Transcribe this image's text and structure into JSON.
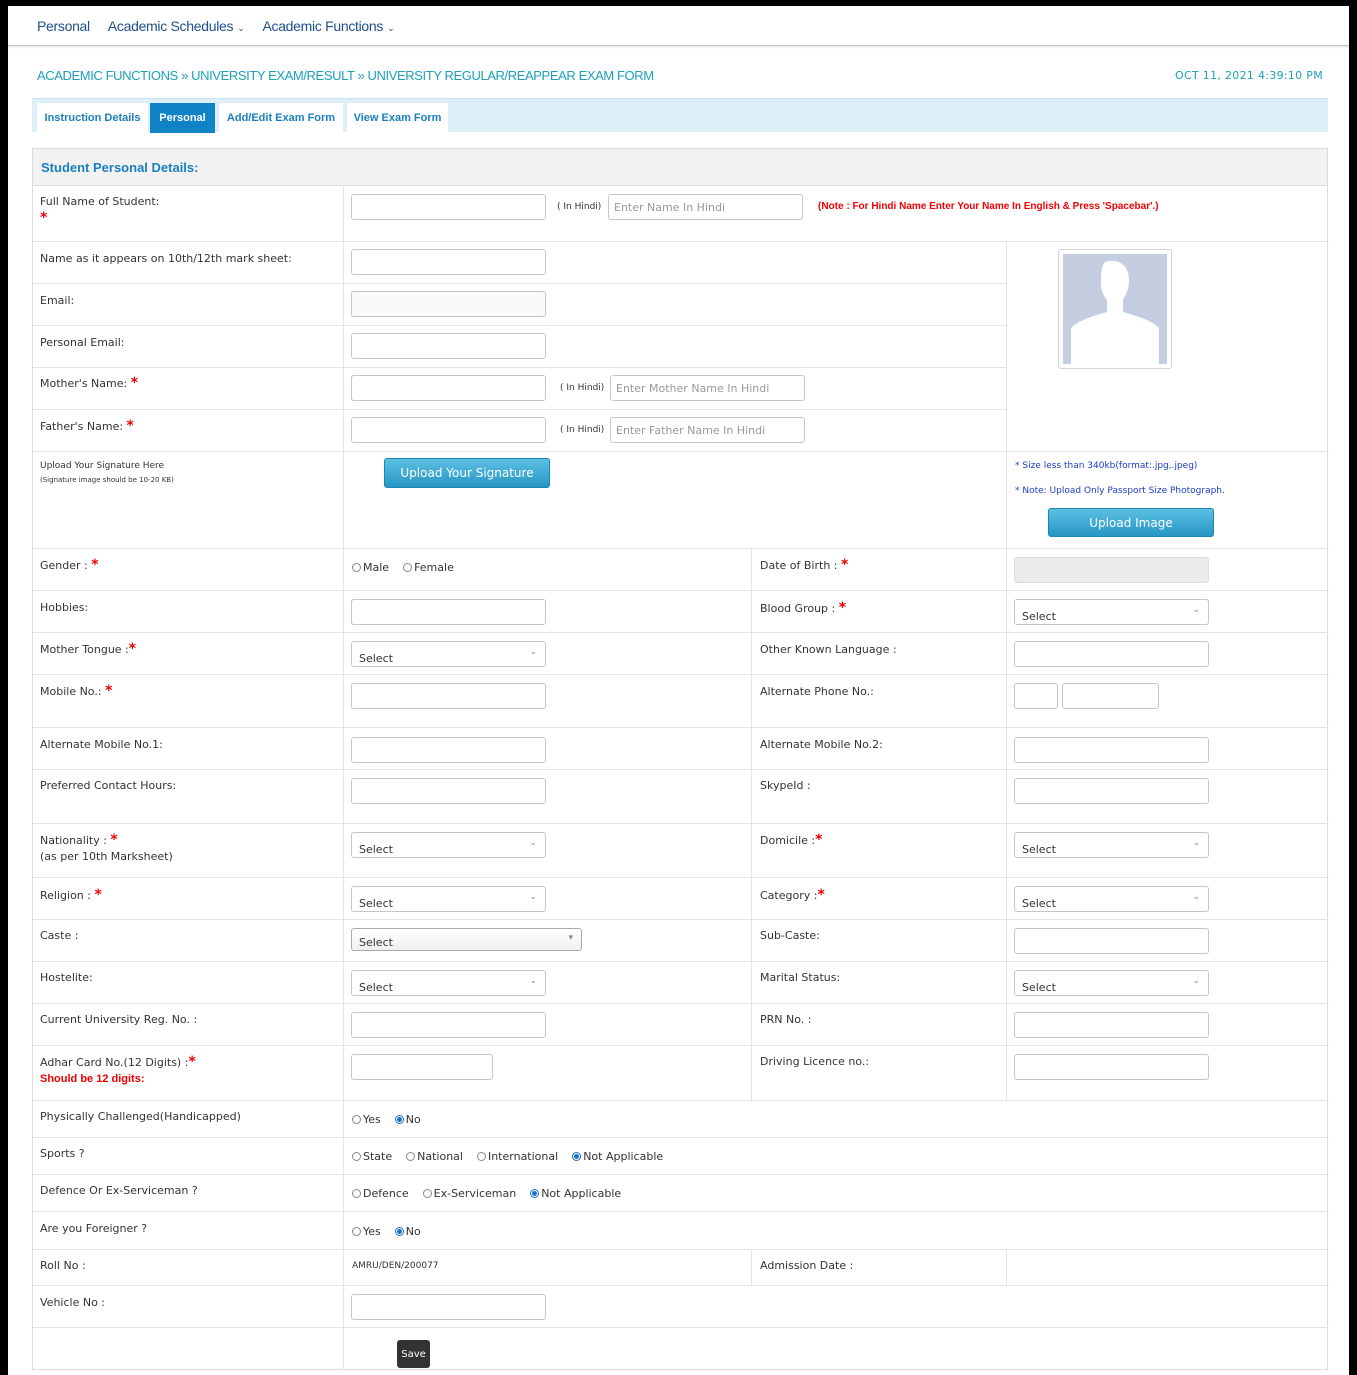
{
  "nav": {
    "items": [
      {
        "label": "Personal",
        "dropdown": false
      },
      {
        "label": "Academic Schedules",
        "dropdown": true
      },
      {
        "label": "Academic Functions",
        "dropdown": true
      }
    ]
  },
  "breadcrumb": "ACADEMIC FUNCTIONS » UNIVERSITY EXAM/RESULT » UNIVERSITY REGULAR/REAPPEAR EXAM FORM",
  "datetime": "OCT 11, 2021  4:39:10 PM",
  "tabs": [
    {
      "label": "Instruction Details",
      "active": false
    },
    {
      "label": "Personal",
      "active": true
    },
    {
      "label": "Add/Edit Exam Form",
      "active": false
    },
    {
      "label": "View Exam Form",
      "active": false
    }
  ],
  "section_title": "Student Personal Details:",
  "labels": {
    "full_name": "Full Name of Student:",
    "in_hindi": "( In Hindi)",
    "hindi_note": "(Note : For Hindi Name Enter Your Name In English & Press 'Spacebar'.)",
    "marksheet_name": "Name as it appears on 10th/12th mark sheet:",
    "email": "Email:",
    "personal_email": "Personal Email:",
    "mother_name": "Mother's Name:",
    "father_name": "Father's Name:",
    "signature_title": "Upload Your Signature Here",
    "signature_hint": "(Signature image should be 10-20 KB)",
    "photo_size": "* Size less than 340kb(format:.jpg,.jpeg)",
    "photo_note": "* Note: Upload Only Passport Size Photograph.",
    "gender": "Gender :",
    "dob": "Date of Birth :",
    "hobbies": "Hobbies:",
    "blood_group": "Blood Group :",
    "mother_tongue": "Mother Tongue :",
    "other_language": "Other Known Language :",
    "mobile": "Mobile No.:",
    "alt_phone": "Alternate Phone No.:",
    "alt_mobile1": "Alternate Mobile No.1:",
    "alt_mobile2": "Alternate Mobile No.2:",
    "contact_hours": "Preferred Contact Hours:",
    "skype": "SkypeId :",
    "nationality": "Nationality :",
    "nationality_sub": "(as per 10th Marksheet)",
    "domicile": "Domicile :",
    "religion": "Religion :",
    "category": "Category :",
    "caste": "Caste :",
    "sub_caste": "Sub-Caste:",
    "hostelite": "Hostelite:",
    "marital": "Marital Status:",
    "univ_reg": "Current University Reg. No. :",
    "prn": "PRN No. :",
    "adhar": "Adhar Card No.(12 Digits) :",
    "adhar_warn": "Should be 12 digits:",
    "licence": "Driving Licence no.:",
    "handicapped": "Physically Challenged(Handicapped)",
    "sports": "Sports ?",
    "defence": "Defence Or Ex-Serviceman ?",
    "foreigner": "Are you Foreigner ?",
    "roll_no": "Roll No :",
    "admission_date": "Admission Date :",
    "vehicle_no": "Vehicle No :"
  },
  "placeholders": {
    "name_hindi": "Enter Name In Hindi",
    "mother_hindi": "Enter Mother Name In Hindi",
    "father_hindi": "Enter Father Name In Hindi"
  },
  "select_default": "Select",
  "radios": {
    "gender": [
      {
        "label": "Male",
        "checked": false
      },
      {
        "label": "Female",
        "checked": false
      }
    ],
    "handicapped": [
      {
        "label": "Yes",
        "checked": false
      },
      {
        "label": "No",
        "checked": true
      }
    ],
    "sports": [
      {
        "label": "State",
        "checked": false
      },
      {
        "label": "National",
        "checked": false
      },
      {
        "label": "International",
        "checked": false
      },
      {
        "label": "Not Applicable",
        "checked": true
      }
    ],
    "defence": [
      {
        "label": "Defence",
        "checked": false
      },
      {
        "label": "Ex-Serviceman",
        "checked": false
      },
      {
        "label": "Not Applicable",
        "checked": true
      }
    ],
    "foreigner": [
      {
        "label": "Yes",
        "checked": false
      },
      {
        "label": "No",
        "checked": true
      }
    ]
  },
  "values": {
    "roll_no": "AMRU/DEN/200077"
  },
  "buttons": {
    "upload_signature": "Upload Your Signature",
    "upload_image": "Upload Image",
    "save": "Save"
  },
  "required_mark": "*",
  "icons": {
    "chevron": "chevron-down-icon",
    "avatar": "avatar-placeholder-icon"
  },
  "colors": {
    "accent": "#1083c6",
    "link": "#1ea0b8",
    "required": "#ee0000"
  }
}
